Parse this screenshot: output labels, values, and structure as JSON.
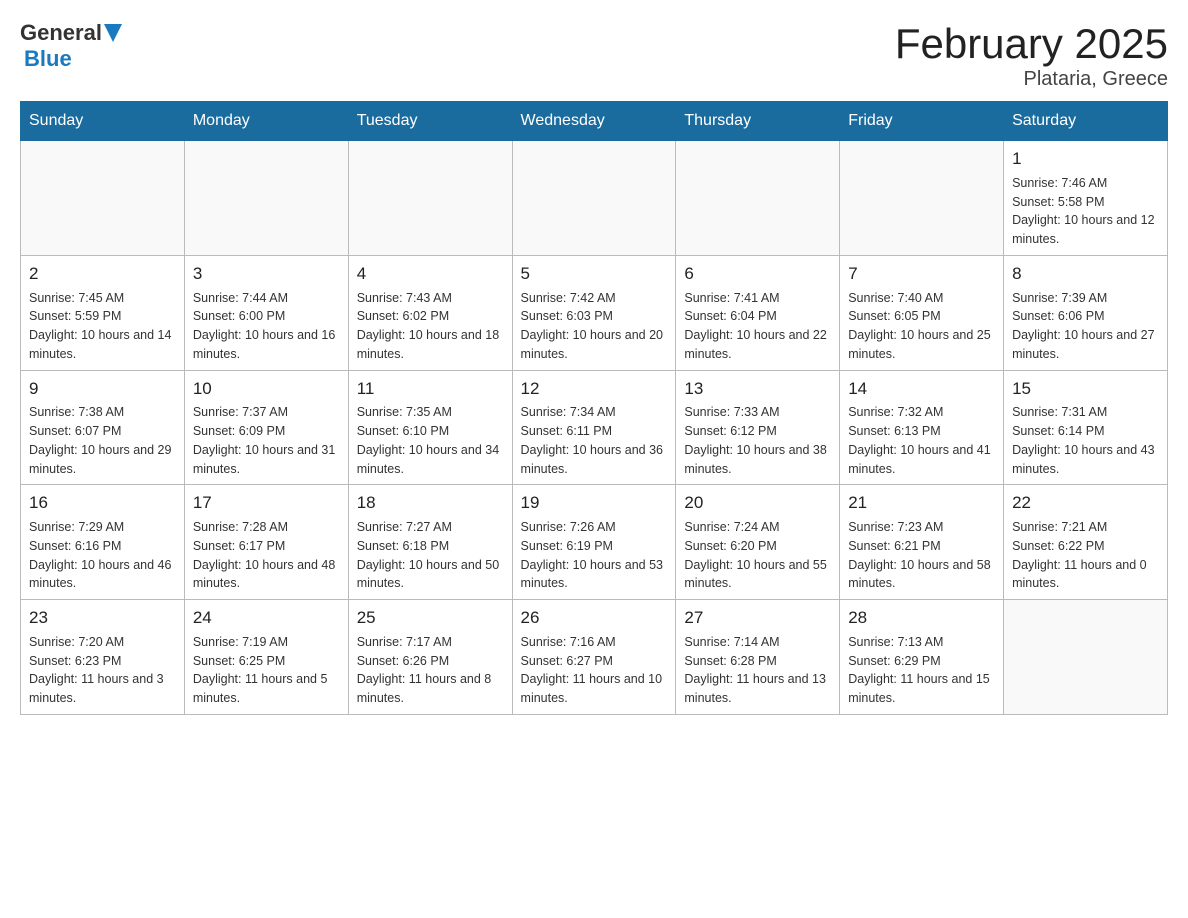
{
  "header": {
    "logo_general": "General",
    "logo_blue": "Blue",
    "month_title": "February 2025",
    "location": "Plataria, Greece"
  },
  "weekdays": [
    "Sunday",
    "Monday",
    "Tuesday",
    "Wednesday",
    "Thursday",
    "Friday",
    "Saturday"
  ],
  "weeks": [
    [
      {
        "day": "",
        "info": ""
      },
      {
        "day": "",
        "info": ""
      },
      {
        "day": "",
        "info": ""
      },
      {
        "day": "",
        "info": ""
      },
      {
        "day": "",
        "info": ""
      },
      {
        "day": "",
        "info": ""
      },
      {
        "day": "1",
        "info": "Sunrise: 7:46 AM\nSunset: 5:58 PM\nDaylight: 10 hours and 12 minutes."
      }
    ],
    [
      {
        "day": "2",
        "info": "Sunrise: 7:45 AM\nSunset: 5:59 PM\nDaylight: 10 hours and 14 minutes."
      },
      {
        "day": "3",
        "info": "Sunrise: 7:44 AM\nSunset: 6:00 PM\nDaylight: 10 hours and 16 minutes."
      },
      {
        "day": "4",
        "info": "Sunrise: 7:43 AM\nSunset: 6:02 PM\nDaylight: 10 hours and 18 minutes."
      },
      {
        "day": "5",
        "info": "Sunrise: 7:42 AM\nSunset: 6:03 PM\nDaylight: 10 hours and 20 minutes."
      },
      {
        "day": "6",
        "info": "Sunrise: 7:41 AM\nSunset: 6:04 PM\nDaylight: 10 hours and 22 minutes."
      },
      {
        "day": "7",
        "info": "Sunrise: 7:40 AM\nSunset: 6:05 PM\nDaylight: 10 hours and 25 minutes."
      },
      {
        "day": "8",
        "info": "Sunrise: 7:39 AM\nSunset: 6:06 PM\nDaylight: 10 hours and 27 minutes."
      }
    ],
    [
      {
        "day": "9",
        "info": "Sunrise: 7:38 AM\nSunset: 6:07 PM\nDaylight: 10 hours and 29 minutes."
      },
      {
        "day": "10",
        "info": "Sunrise: 7:37 AM\nSunset: 6:09 PM\nDaylight: 10 hours and 31 minutes."
      },
      {
        "day": "11",
        "info": "Sunrise: 7:35 AM\nSunset: 6:10 PM\nDaylight: 10 hours and 34 minutes."
      },
      {
        "day": "12",
        "info": "Sunrise: 7:34 AM\nSunset: 6:11 PM\nDaylight: 10 hours and 36 minutes."
      },
      {
        "day": "13",
        "info": "Sunrise: 7:33 AM\nSunset: 6:12 PM\nDaylight: 10 hours and 38 minutes."
      },
      {
        "day": "14",
        "info": "Sunrise: 7:32 AM\nSunset: 6:13 PM\nDaylight: 10 hours and 41 minutes."
      },
      {
        "day": "15",
        "info": "Sunrise: 7:31 AM\nSunset: 6:14 PM\nDaylight: 10 hours and 43 minutes."
      }
    ],
    [
      {
        "day": "16",
        "info": "Sunrise: 7:29 AM\nSunset: 6:16 PM\nDaylight: 10 hours and 46 minutes."
      },
      {
        "day": "17",
        "info": "Sunrise: 7:28 AM\nSunset: 6:17 PM\nDaylight: 10 hours and 48 minutes."
      },
      {
        "day": "18",
        "info": "Sunrise: 7:27 AM\nSunset: 6:18 PM\nDaylight: 10 hours and 50 minutes."
      },
      {
        "day": "19",
        "info": "Sunrise: 7:26 AM\nSunset: 6:19 PM\nDaylight: 10 hours and 53 minutes."
      },
      {
        "day": "20",
        "info": "Sunrise: 7:24 AM\nSunset: 6:20 PM\nDaylight: 10 hours and 55 minutes."
      },
      {
        "day": "21",
        "info": "Sunrise: 7:23 AM\nSunset: 6:21 PM\nDaylight: 10 hours and 58 minutes."
      },
      {
        "day": "22",
        "info": "Sunrise: 7:21 AM\nSunset: 6:22 PM\nDaylight: 11 hours and 0 minutes."
      }
    ],
    [
      {
        "day": "23",
        "info": "Sunrise: 7:20 AM\nSunset: 6:23 PM\nDaylight: 11 hours and 3 minutes."
      },
      {
        "day": "24",
        "info": "Sunrise: 7:19 AM\nSunset: 6:25 PM\nDaylight: 11 hours and 5 minutes."
      },
      {
        "day": "25",
        "info": "Sunrise: 7:17 AM\nSunset: 6:26 PM\nDaylight: 11 hours and 8 minutes."
      },
      {
        "day": "26",
        "info": "Sunrise: 7:16 AM\nSunset: 6:27 PM\nDaylight: 11 hours and 10 minutes."
      },
      {
        "day": "27",
        "info": "Sunrise: 7:14 AM\nSunset: 6:28 PM\nDaylight: 11 hours and 13 minutes."
      },
      {
        "day": "28",
        "info": "Sunrise: 7:13 AM\nSunset: 6:29 PM\nDaylight: 11 hours and 15 minutes."
      },
      {
        "day": "",
        "info": ""
      }
    ]
  ]
}
